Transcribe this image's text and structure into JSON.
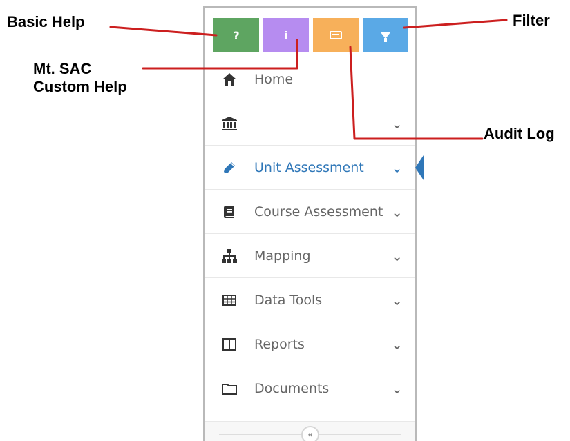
{
  "annotations": {
    "basic_help": "Basic Help",
    "custom_help_line1": "Mt. SAC",
    "custom_help_line2": "Custom Help",
    "filter": "Filter",
    "audit_log": "Audit Log"
  },
  "toolbar": {
    "help_label": "?",
    "custom_help_label": "i",
    "audit_icon": "audit-log-icon",
    "filter_icon": "filter-icon",
    "colors": {
      "help": "#5ea561",
      "custom": "#b68cf0",
      "audit": "#f7b05a",
      "filter": "#5aa9e6"
    }
  },
  "menu": {
    "items": [
      {
        "label": "Home",
        "icon": "home-icon",
        "has_chevron": false,
        "active": false
      },
      {
        "label": "",
        "icon": "institution-icon",
        "has_chevron": true,
        "active": false
      },
      {
        "label": "Unit Assessment",
        "icon": "pencil-icon",
        "has_chevron": true,
        "active": true
      },
      {
        "label": "Course Assessment",
        "icon": "book-icon",
        "has_chevron": true,
        "active": false
      },
      {
        "label": "Mapping",
        "icon": "sitemap-icon",
        "has_chevron": true,
        "active": false
      },
      {
        "label": "Data Tools",
        "icon": "table-icon",
        "has_chevron": true,
        "active": false
      },
      {
        "label": "Reports",
        "icon": "columns-icon",
        "has_chevron": true,
        "active": false
      },
      {
        "label": "Documents",
        "icon": "folder-icon",
        "has_chevron": true,
        "active": false
      }
    ],
    "chevron_glyph": "⌄",
    "collapse_glyph": "«",
    "active_color": "#2f77b8"
  }
}
